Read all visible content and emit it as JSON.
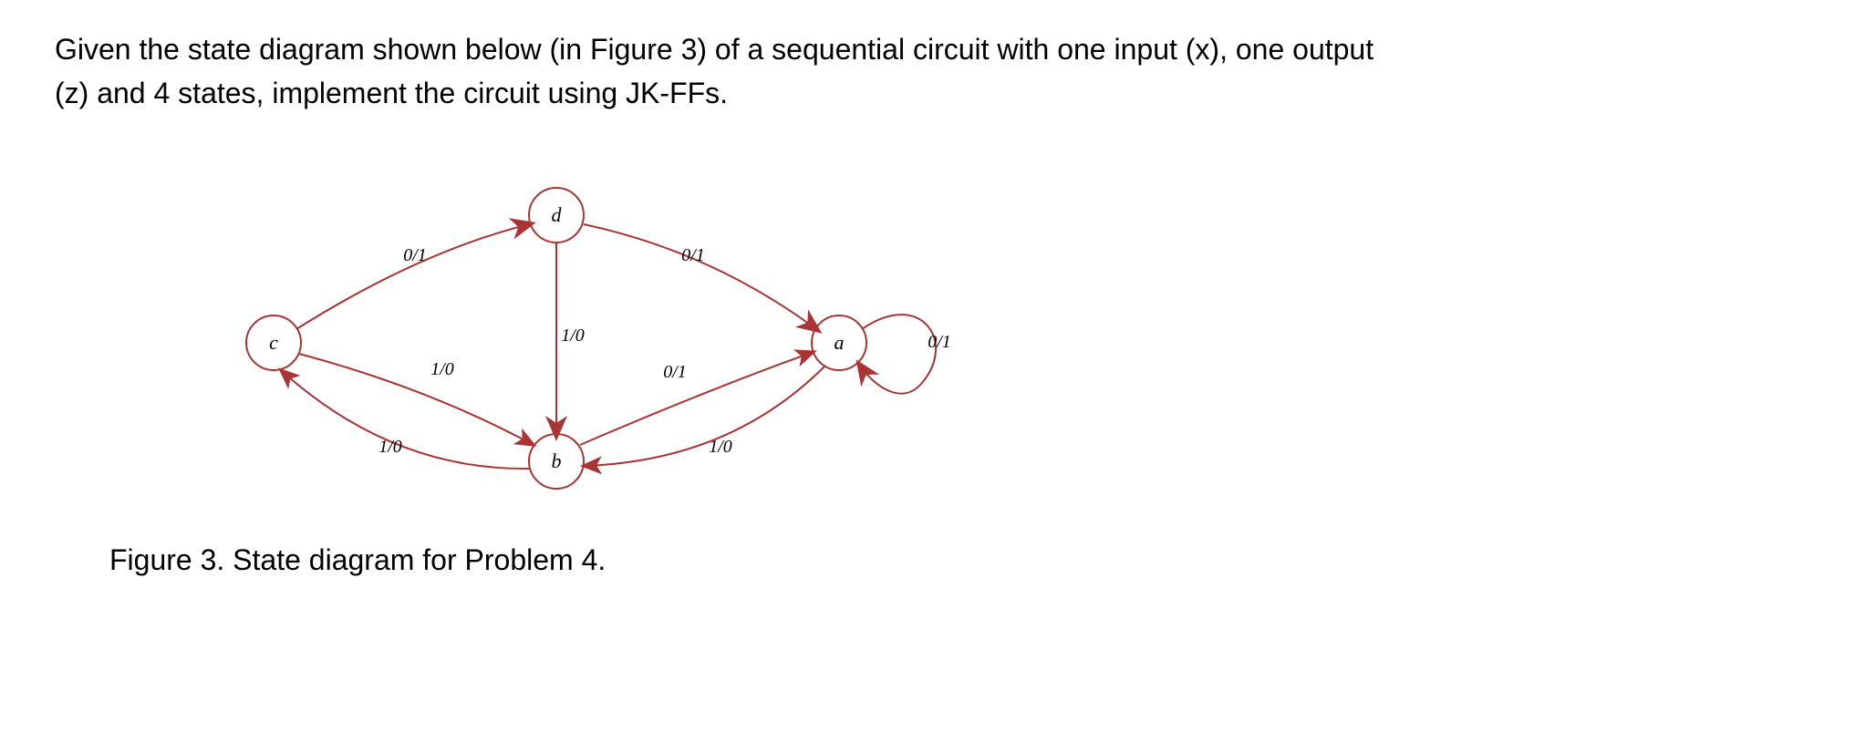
{
  "problem": {
    "line1": "Given the state diagram shown below (in Figure 3) of a sequential circuit with one input (x), one output",
    "line2": "(z) and 4 states, implement the circuit using JK-FFs."
  },
  "caption": "Figure 3. State diagram for Problem 4.",
  "states": {
    "a": "a",
    "b": "b",
    "c": "c",
    "d": "d"
  },
  "state_diagram": {
    "input": "x",
    "output": "z",
    "num_states": 4,
    "transitions": [
      {
        "from": "a",
        "to": "a",
        "input": 0,
        "output": 1,
        "label": "0/1"
      },
      {
        "from": "a",
        "to": "b",
        "input": 1,
        "output": 0,
        "label": "1/0"
      },
      {
        "from": "b",
        "to": "a",
        "input": 0,
        "output": 1,
        "label": "0/1"
      },
      {
        "from": "b",
        "to": "c",
        "input": 1,
        "output": 0,
        "label": "1/0"
      },
      {
        "from": "c",
        "to": "d",
        "input": 0,
        "output": 1,
        "label": "0/1"
      },
      {
        "from": "c",
        "to": "b",
        "input": 1,
        "output": 0,
        "label": "1/0"
      },
      {
        "from": "d",
        "to": "a",
        "input": 0,
        "output": 1,
        "label": "0/1"
      },
      {
        "from": "d",
        "to": "b",
        "input": 1,
        "output": 0,
        "label": "1/0"
      }
    ]
  },
  "edge_labels": {
    "cd": "0/1",
    "da": "0/1",
    "db": "1/0",
    "cb": "1/0",
    "ba": "0/1",
    "ab": "1/0",
    "bc": "1/0",
    "aa": "0/1"
  }
}
